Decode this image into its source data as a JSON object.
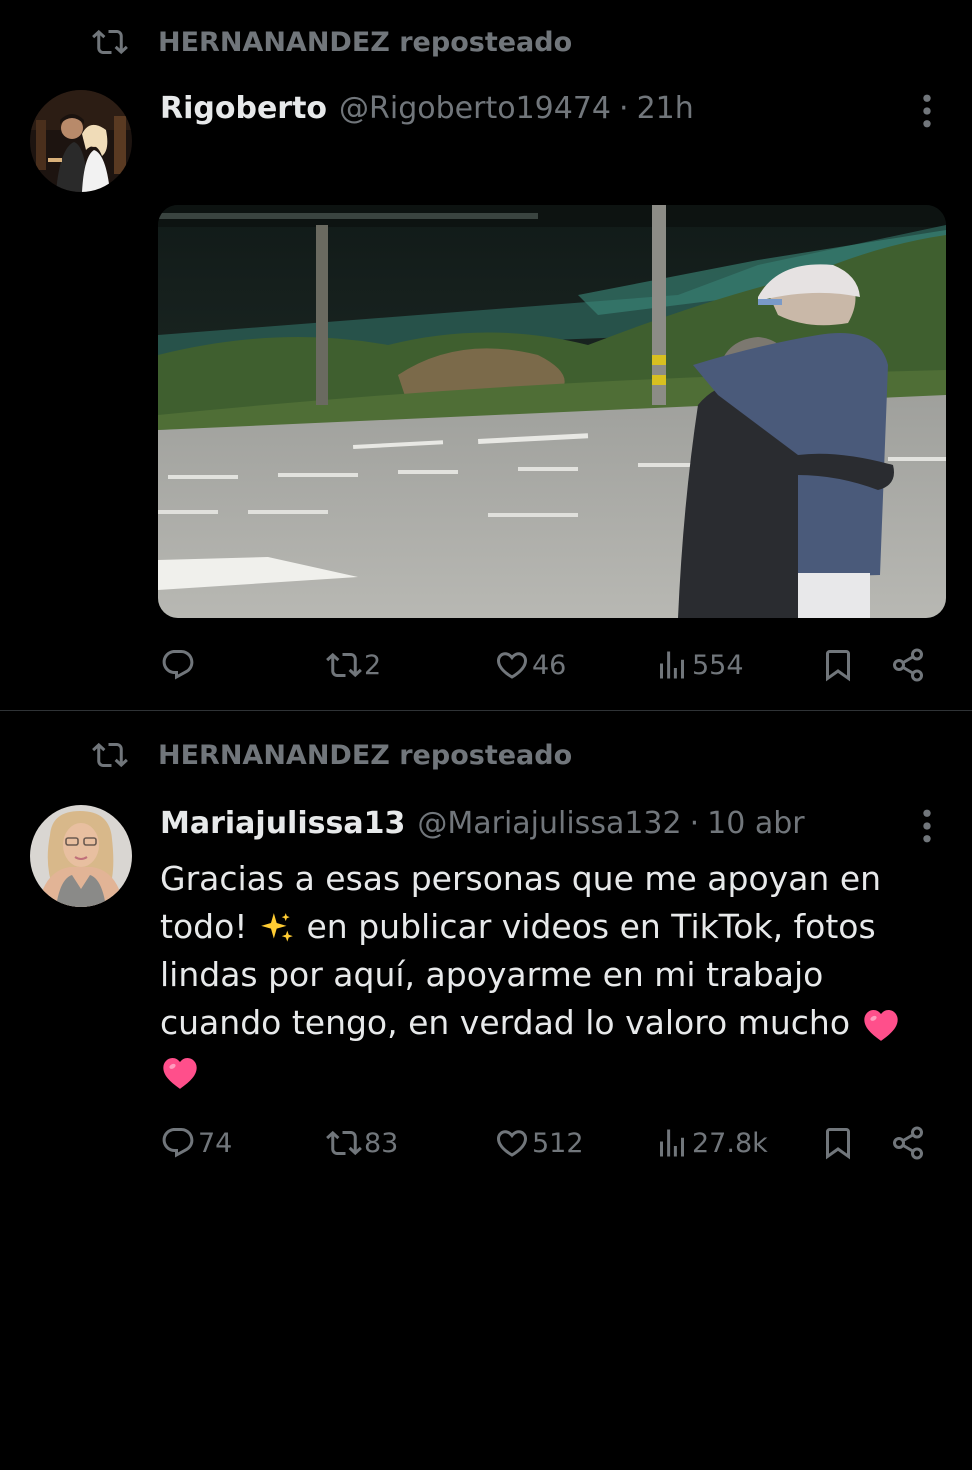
{
  "posts": [
    {
      "repost_label": "HERNANANDEZ reposteado",
      "author_name": "Rigoberto",
      "author_handle": "@Rigoberto19474",
      "separator": "·",
      "time": "21h",
      "text_lines": [],
      "media": "video-thumbnail",
      "actions": {
        "replies": "",
        "reposts": "2",
        "likes": "46",
        "views": "554"
      }
    },
    {
      "repost_label": "HERNANANDEZ reposteado",
      "author_name": "Mariajulissa13",
      "author_handle": "@Mariajulissa132",
      "separator": "·",
      "time": "10 abr",
      "text_lines": [
        "Gracias a esas personas que me apoyan en",
        "todo!",
        "en publicar videos en TikTok, fotos",
        "lindas por aquí, apoyarme en mi trabajo",
        "cuando tengo, en verdad lo valoro mucho"
      ],
      "actions": {
        "replies": "74",
        "reposts": "83",
        "likes": "512",
        "views": "27.8k"
      }
    }
  ],
  "icons": {
    "repost": "repost-icon",
    "reply": "reply-icon",
    "like": "heart-icon",
    "views": "views-icon",
    "bookmark": "bookmark-icon",
    "share": "share-icon",
    "more": "more-vertical-icon",
    "sparkles": "sparkles-emoji",
    "heart_emoji": "pink-heart-emoji"
  },
  "colors": {
    "background": "#000000",
    "text_primary": "#e7e9ea",
    "text_secondary": "#71767b",
    "divider": "#2f3336",
    "heart_emoji": "#ff4f8b",
    "sparkles": "#ffcc33"
  }
}
